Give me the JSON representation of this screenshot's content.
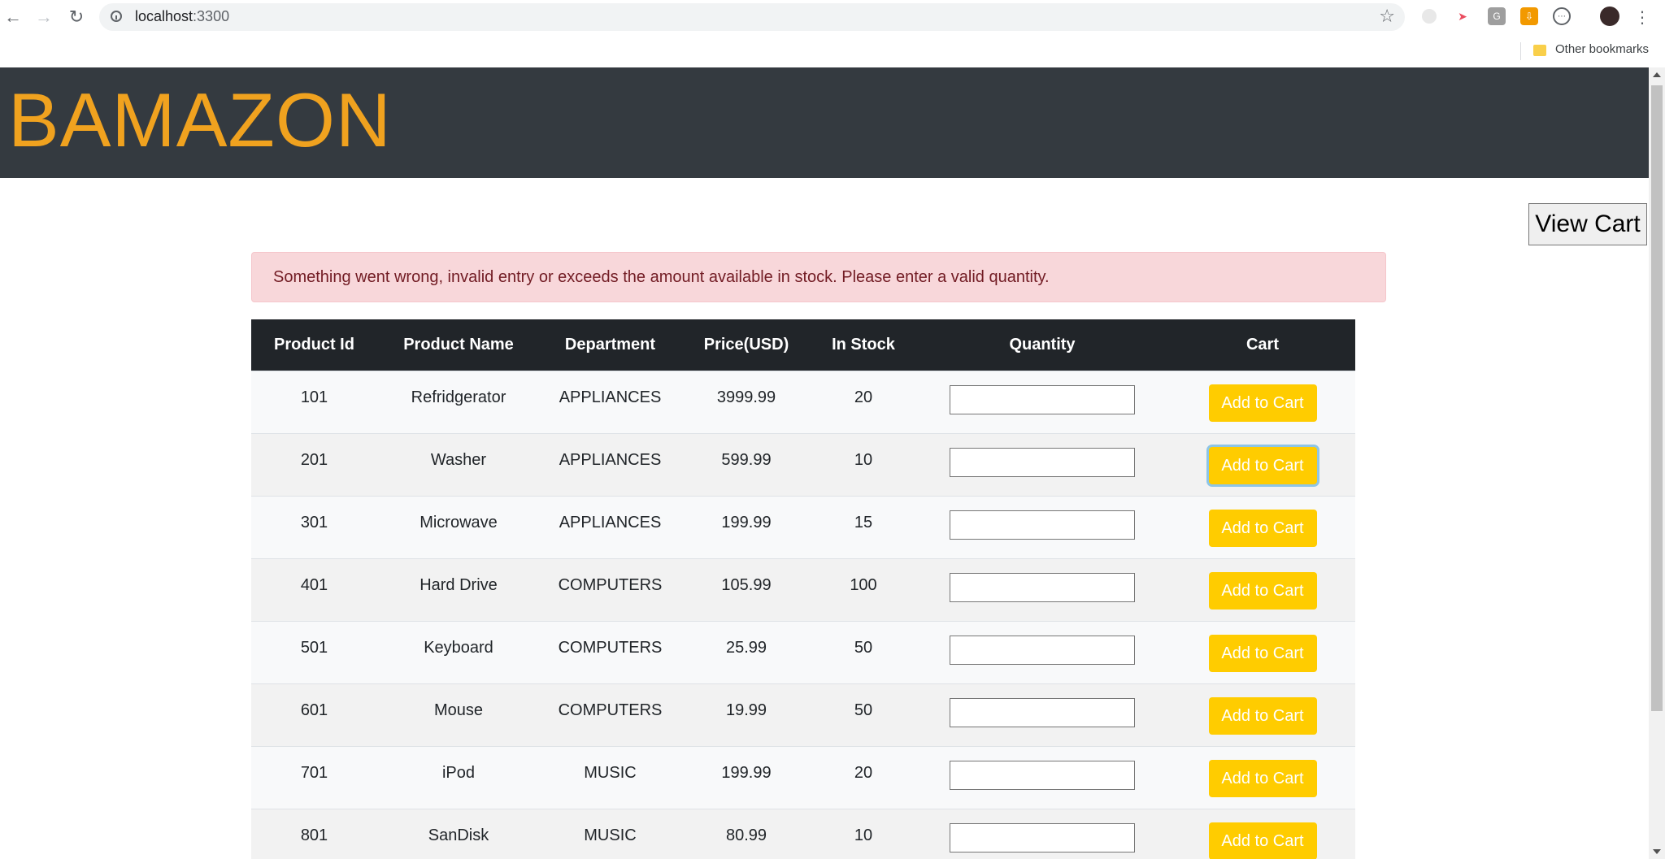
{
  "browser": {
    "url_host": "localhost",
    "url_port": ":3300",
    "bookmarks": {
      "other_label": "Other bookmarks"
    }
  },
  "header": {
    "brand": "BAMAZON",
    "brand_color": "#f0a21f"
  },
  "view_cart_label": "View Cart",
  "alert": {
    "message": "Something went wrong, invalid entry or exceeds the amount available in stock. Please enter a valid quantity."
  },
  "table": {
    "columns": [
      "Product Id",
      "Product Name",
      "Department",
      "Price(USD)",
      "In Stock",
      "Quantity",
      "Cart"
    ],
    "add_label": "Add to Cart",
    "rows": [
      {
        "id": "101",
        "name": "Refridgerator",
        "department": "APPLIANCES",
        "price": "3999.99",
        "stock": "20"
      },
      {
        "id": "201",
        "name": "Washer",
        "department": "APPLIANCES",
        "price": "599.99",
        "stock": "10"
      },
      {
        "id": "301",
        "name": "Microwave",
        "department": "APPLIANCES",
        "price": "199.99",
        "stock": "15"
      },
      {
        "id": "401",
        "name": "Hard Drive",
        "department": "COMPUTERS",
        "price": "105.99",
        "stock": "100"
      },
      {
        "id": "501",
        "name": "Keyboard",
        "department": "COMPUTERS",
        "price": "25.99",
        "stock": "50"
      },
      {
        "id": "601",
        "name": "Mouse",
        "department": "COMPUTERS",
        "price": "19.99",
        "stock": "50"
      },
      {
        "id": "701",
        "name": "iPod",
        "department": "MUSIC",
        "price": "199.99",
        "stock": "20"
      },
      {
        "id": "801",
        "name": "SanDisk",
        "department": "MUSIC",
        "price": "80.99",
        "stock": "10"
      }
    ]
  }
}
